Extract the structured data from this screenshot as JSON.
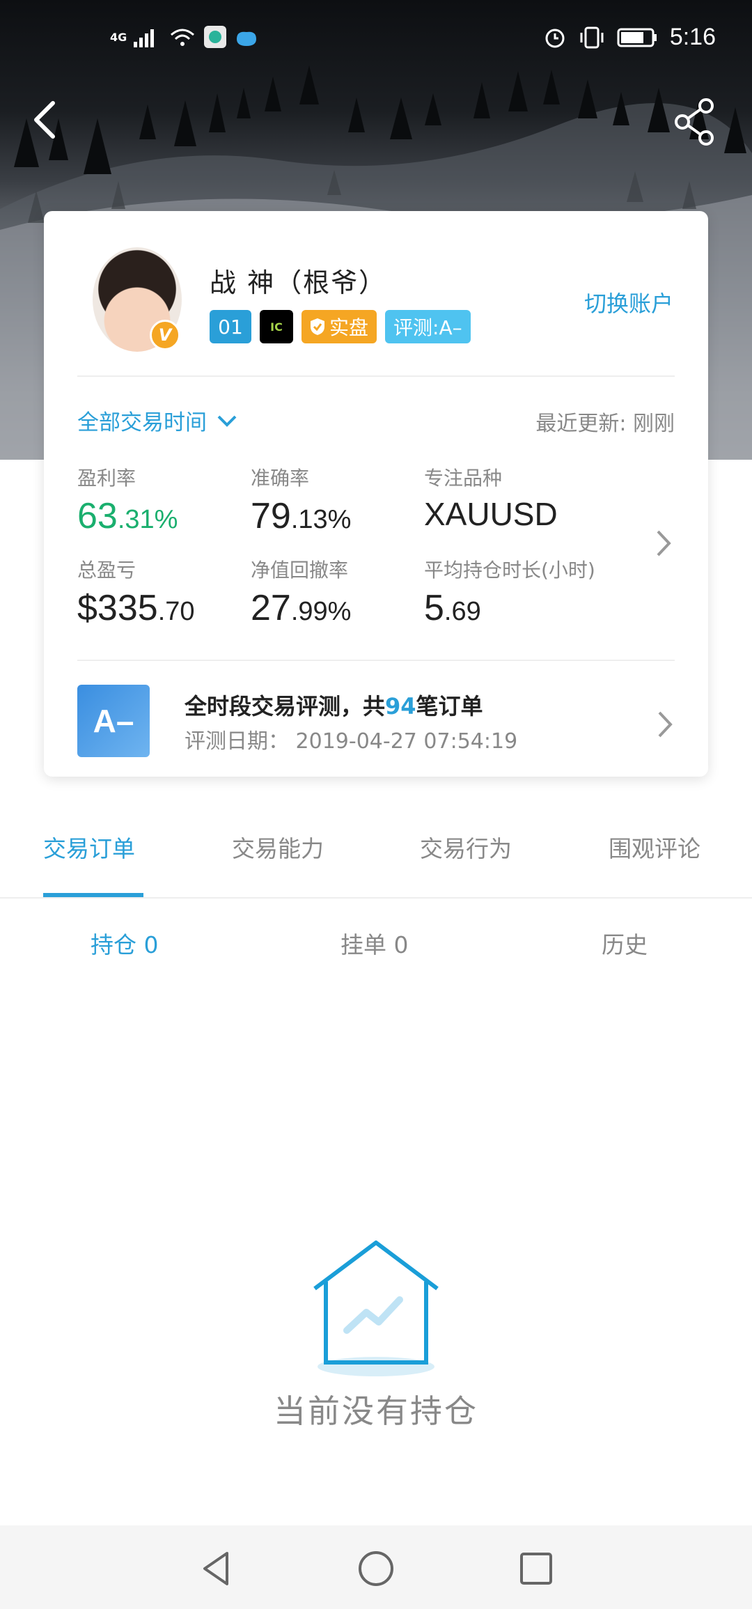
{
  "status_bar": {
    "network": "4G",
    "time": "5:16"
  },
  "header": {
    "back_icon": "chevron-left-icon",
    "share_icon": "share-icon"
  },
  "profile": {
    "name": "战 神（根爷）",
    "verified_badge": "V",
    "badges": {
      "level": "01",
      "broker": "IC",
      "real_account": "实盘",
      "rating": "评测:A–"
    },
    "switch_account": "切换账户"
  },
  "filter": {
    "time_range": "全部交易时间",
    "last_update": "最近更新: 刚刚"
  },
  "stats": {
    "profit_rate": {
      "label": "盈利率",
      "int": "63",
      "dec": ".31%"
    },
    "accuracy": {
      "label": "准确率",
      "int": "79",
      "dec": ".13%"
    },
    "focus_symbol": {
      "label": "专注品种",
      "value": "XAUUSD"
    },
    "total_pl": {
      "label": "总盈亏",
      "int": "$335",
      "dec": ".70"
    },
    "max_drawdown": {
      "label": "净值回撤率",
      "int": "27",
      "dec": ".99%"
    },
    "avg_hold": {
      "label": "平均持仓时长(小时)",
      "int": "5",
      "dec": ".69"
    }
  },
  "evaluation": {
    "grade": "A–",
    "title_prefix": "全时段交易评测，共",
    "order_count": "94",
    "title_suffix": "笔订单",
    "date": "评测日期：  2019-04-27 07:54:19"
  },
  "tabs": [
    "交易订单",
    "交易能力",
    "交易行为",
    "围观评论"
  ],
  "subtabs": [
    "持仓 0",
    "挂单 0",
    "历史"
  ],
  "empty_state": {
    "icon": "house-chart-icon",
    "text": "当前没有持仓"
  },
  "colors": {
    "accent": "#2a9fd8",
    "profit_green": "#1aaf6e",
    "badge_orange": "#f5a623"
  }
}
